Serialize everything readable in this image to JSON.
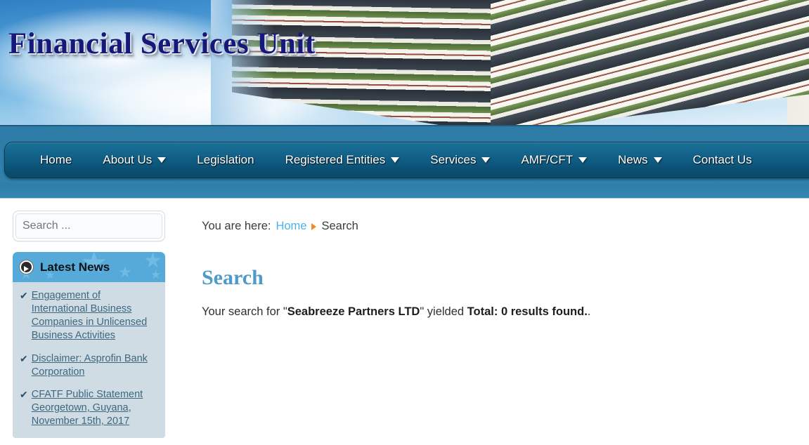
{
  "site": {
    "title": "Financial Services Unit"
  },
  "nav": {
    "items": [
      {
        "label": "Home",
        "has_dropdown": false
      },
      {
        "label": "About Us",
        "has_dropdown": true
      },
      {
        "label": "Legislation",
        "has_dropdown": false
      },
      {
        "label": "Registered Entities",
        "has_dropdown": true
      },
      {
        "label": "Services",
        "has_dropdown": true
      },
      {
        "label": "AMF/CFT",
        "has_dropdown": true
      },
      {
        "label": "News",
        "has_dropdown": true
      },
      {
        "label": "Contact Us",
        "has_dropdown": false
      }
    ]
  },
  "sidebar": {
    "search": {
      "placeholder": "Search ...",
      "value": ""
    },
    "news_module": {
      "icon": "arrow-circle-right-icon",
      "heading": "Latest News",
      "items": [
        {
          "bullet": "check-icon",
          "label": "Engagement of International Business Companies in Unlicensed Business Activities"
        },
        {
          "bullet": "check-icon",
          "label": "Disclaimer: Asprofin Bank Corporation"
        },
        {
          "bullet": "check-icon",
          "label": "CFATF Public Statement Georgetown, Guyana, November 15th, 2017"
        }
      ]
    }
  },
  "main": {
    "breadcrumb": {
      "prefix": "You are here:",
      "home": "Home",
      "separator": "triangle-right-icon",
      "current": "Search"
    },
    "page_title": "Search",
    "result": {
      "prefix": "Your search for \"",
      "query": "Seabreeze Partners LTD",
      "middle": "\" yielded ",
      "total": "Total: 0 results found.",
      "suffix": "."
    }
  },
  "colors": {
    "title_navy": "#16197a",
    "nav_gradient_top": "#1b7098",
    "nav_gradient_bottom": "#0a4868",
    "band_blue": "#2f7ea9",
    "news_head_blue": "#56aada",
    "news_list_bg": "#cfdce3",
    "heading_blue": "#4f9ac8",
    "crumb_link_blue": "#4cb3e4",
    "crumb_sep_orange": "#f08b1d",
    "news_link_blue": "#3f6880"
  }
}
